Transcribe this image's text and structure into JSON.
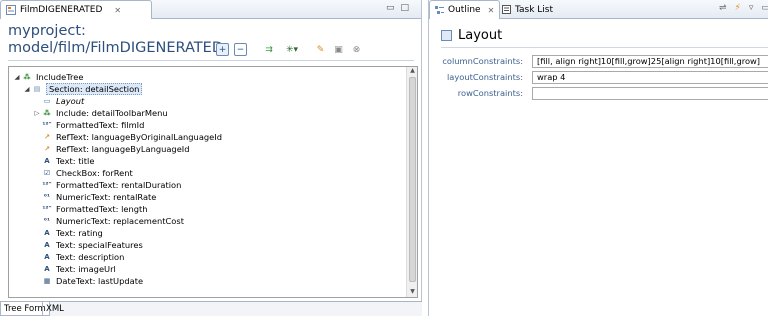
{
  "editor": {
    "tab_title": "FilmDIGENERATED",
    "project": "myproject:",
    "path": "model/film/FilmDIGENERATED",
    "tree": [
      {
        "depth": 0,
        "toggle": "◢",
        "icon": "include-icon",
        "label": "IncludeTree"
      },
      {
        "depth": 1,
        "toggle": "◢",
        "icon": "section-icon",
        "label": "Section: detailSection",
        "selected": true
      },
      {
        "depth": 2,
        "toggle": "",
        "icon": "layout-icon",
        "label": "Layout",
        "italic": true
      },
      {
        "depth": 2,
        "toggle": "▷",
        "icon": "include-icon",
        "label": "Include: detailToolbarMenu"
      },
      {
        "depth": 2,
        "toggle": "",
        "icon": "formatted-text-icon",
        "label": "FormattedText: filmId"
      },
      {
        "depth": 2,
        "toggle": "",
        "icon": "reftext-icon",
        "label": "RefText: languageByOriginalLanguageId"
      },
      {
        "depth": 2,
        "toggle": "",
        "icon": "reftext-icon",
        "label": "RefText: languageByLanguageId"
      },
      {
        "depth": 2,
        "toggle": "",
        "icon": "text-icon",
        "label": "Text: title"
      },
      {
        "depth": 2,
        "toggle": "",
        "icon": "checkbox-icon",
        "label": "CheckBox: forRent"
      },
      {
        "depth": 2,
        "toggle": "",
        "icon": "formatted-text-icon",
        "label": "FormattedText: rentalDuration"
      },
      {
        "depth": 2,
        "toggle": "",
        "icon": "numeric-text-icon",
        "label": "NumericText: rentalRate"
      },
      {
        "depth": 2,
        "toggle": "",
        "icon": "formatted-text-icon",
        "label": "FormattedText: length"
      },
      {
        "depth": 2,
        "toggle": "",
        "icon": "numeric-text-icon",
        "label": "NumericText: replacementCost"
      },
      {
        "depth": 2,
        "toggle": "",
        "icon": "text-icon",
        "label": "Text: rating"
      },
      {
        "depth": 2,
        "toggle": "",
        "icon": "text-icon",
        "label": "Text: specialFeatures"
      },
      {
        "depth": 2,
        "toggle": "",
        "icon": "text-icon",
        "label": "Text: description"
      },
      {
        "depth": 2,
        "toggle": "",
        "icon": "text-icon",
        "label": "Text: imageUrl"
      },
      {
        "depth": 2,
        "toggle": "",
        "icon": "date-text-icon",
        "label": "DateText: lastUpdate"
      }
    ],
    "bottom_tabs": [
      "Tree Form",
      "XML"
    ]
  },
  "outline": {
    "tabs": [
      "Outline",
      "Task List"
    ],
    "title": "Layout",
    "properties": [
      {
        "label": "columnConstraints:",
        "value": "[fill, align right]10[fill,grow]25[align right]10[fill,grow]"
      },
      {
        "label": "layoutConstraints:",
        "value": "wrap 4"
      },
      {
        "label": "rowConstraints:",
        "value": ""
      }
    ]
  },
  "colors": {
    "header_text": "#2c4f7d",
    "label_text": "#3a5f8f",
    "selection": "#dce9f8"
  }
}
